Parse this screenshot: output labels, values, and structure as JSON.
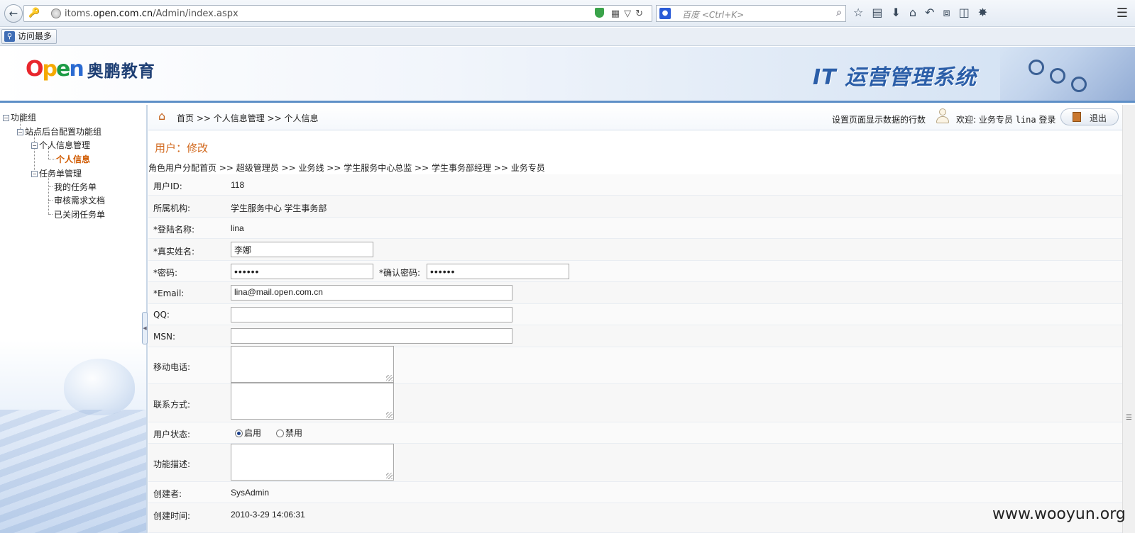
{
  "browser": {
    "url_prefix": "itoms.",
    "url_domain": "open.com.cn",
    "url_path": "/Admin/index.aspx",
    "search_placeholder": "百度 <Ctrl+K>",
    "bookmark_label": "访问最多"
  },
  "header": {
    "logo_text": "奥鹏教育",
    "system_title": "IT 运营管理系统"
  },
  "sidebar": {
    "root": "功能组",
    "group": "站点后台配置功能组",
    "personal_mgmt": "个人信息管理",
    "personal_info": "个人信息",
    "task_mgmt": "任务单管理",
    "my_tasks": "我的任务单",
    "review_docs": "审核需求文档",
    "closed_tasks": "已关闭任务单"
  },
  "topbar": {
    "breadcrumb": "首页 >> 个人信息管理 >> 个人信息",
    "row_count_link": "设置页面显示数据的行数",
    "welcome_prefix": "欢迎: 业务专员",
    "welcome_user": "lina",
    "welcome_suffix": "登录",
    "logout_label": "退出"
  },
  "form": {
    "title": "用户：修改",
    "role_path": "角色用户分配首页 >> 超级管理员 >> 业务线 >> 学生服务中心总监 >> 学生事务部经理 >> 业务专员",
    "user_id_label": "用户ID:",
    "user_id_value": "118",
    "org_label": "所属机构:",
    "org_value": "学生服务中心 学生事务部",
    "login_label": "*登陆名称:",
    "login_value": "lina",
    "realname_label": "*真实姓名:",
    "realname_value": "李娜",
    "password_label": "*密码:",
    "password_value": "••••••",
    "confirm_label": "*确认密码:",
    "confirm_value": "••••••",
    "email_label": "*Email:",
    "email_value": "lina@mail.open.com.cn",
    "qq_label": "QQ:",
    "qq_value": "",
    "msn_label": "MSN:",
    "msn_value": "",
    "mobile_label": "移动电话:",
    "contact_label": "联系方式:",
    "status_label": "用户状态:",
    "status_enabled": "启用",
    "status_disabled": "禁用",
    "desc_label": "功能描述:",
    "creator_label": "创建者:",
    "creator_value": "SysAdmin",
    "created_label": "创建时间:",
    "created_value": "2010-3-29 14:06:31"
  },
  "watermark": "www.wooyun.org"
}
